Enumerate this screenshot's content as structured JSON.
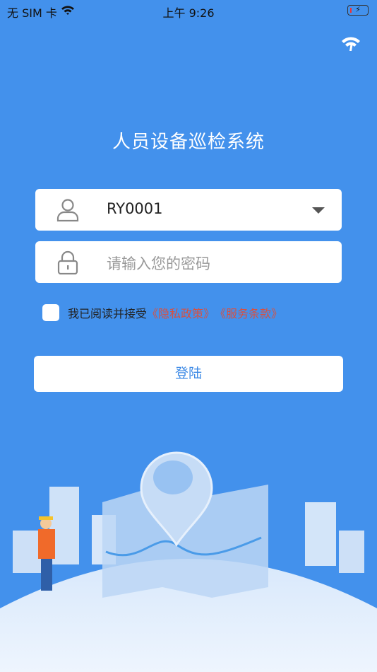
{
  "status": {
    "carrier": "无 SIM 卡",
    "time": "上午 9:26",
    "battery": "⚡"
  },
  "app": {
    "title": "人员设备巡检系统"
  },
  "form": {
    "username": "RY0001",
    "password_placeholder": "请输入您的密码",
    "agree_text": "我已阅读并接受",
    "privacy_link": "《隐私政策》",
    "terms_link": "《服务条款》",
    "login_label": "登陆"
  },
  "colors": {
    "background": "#4391ec",
    "link": "#d9503f",
    "button_text": "#3f8be6"
  }
}
